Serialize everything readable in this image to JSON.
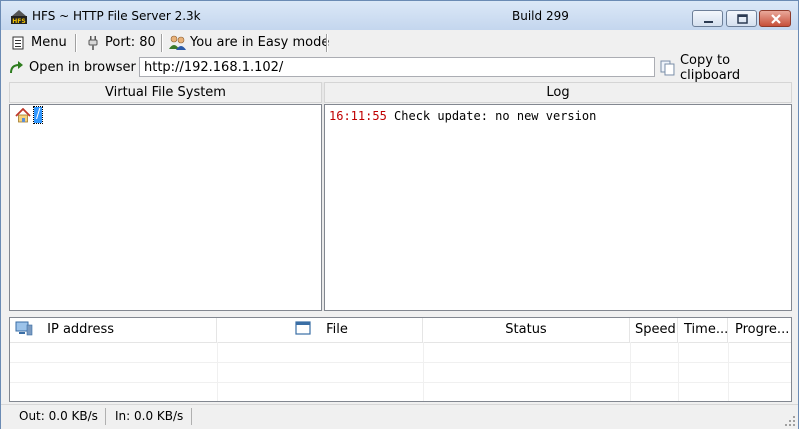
{
  "window": {
    "title": "HFS ~ HTTP File Server 2.3k",
    "build": "Build 299",
    "app_icon_label": "HFS"
  },
  "toolbar": {
    "menu_label": "Menu",
    "port_label": "Port: 80",
    "mode_label": "You are in Easy mode"
  },
  "urlbar": {
    "open_label": "Open in browser",
    "url_value": "http://192.168.1.102/",
    "copy_label": "Copy to clipboard"
  },
  "vfs": {
    "header": "Virtual File System",
    "root_label": "/"
  },
  "log": {
    "header": "Log",
    "entries": [
      {
        "time": "16:11:55",
        "message": "Check update: no new version"
      }
    ]
  },
  "connections": {
    "columns": [
      "IP address",
      "File",
      "Status",
      "Speed",
      "Time...",
      "Progre..."
    ]
  },
  "statusbar": {
    "out": "Out: 0.0 KB/s",
    "in": "In: 0.0 KB/s"
  },
  "icons": {
    "app": "hfs-logo-icon",
    "menu": "menu-icon",
    "port": "plug-icon",
    "mode": "users-icon",
    "open": "arrow-icon",
    "copy": "clipboard-icon",
    "home": "home-icon",
    "ip": "computer-icon",
    "file": "window-icon"
  }
}
